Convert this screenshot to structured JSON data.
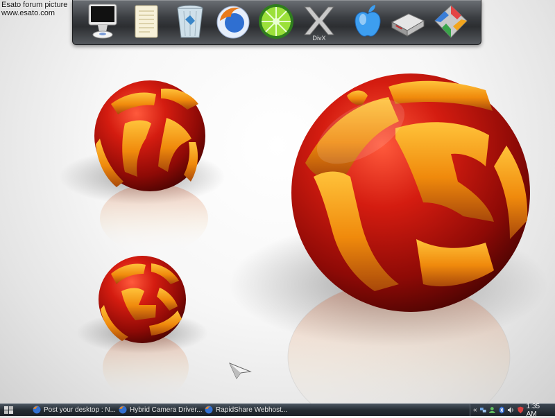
{
  "watermark": {
    "line1": "Esato forum picture",
    "line2": "www.esato.com"
  },
  "dock": {
    "items": [
      {
        "name": "imac-computer-icon"
      },
      {
        "name": "notepad-document-icon"
      },
      {
        "name": "recycle-bin-icon"
      },
      {
        "name": "firefox-browser-icon"
      },
      {
        "name": "limewire-icon"
      },
      {
        "name": "divx-icon",
        "label": "DivX"
      },
      {
        "name": "apple-logo-icon"
      },
      {
        "name": "hard-drive-icon"
      },
      {
        "name": "maze-3d-icon"
      }
    ]
  },
  "taskbar": {
    "tasks": [
      {
        "label": "Post your desktop : N..."
      },
      {
        "label": "Hybrid Camera Driver..."
      },
      {
        "label": "RapidShare Webhost..."
      }
    ],
    "tray": {
      "arrow": "«",
      "clock": "1:35 AM"
    }
  },
  "colors": {
    "sphere_red": "#c0120c",
    "sphere_orange": "#f0900e",
    "taskbar": "#1f252b",
    "dock": "#3a3d41"
  }
}
